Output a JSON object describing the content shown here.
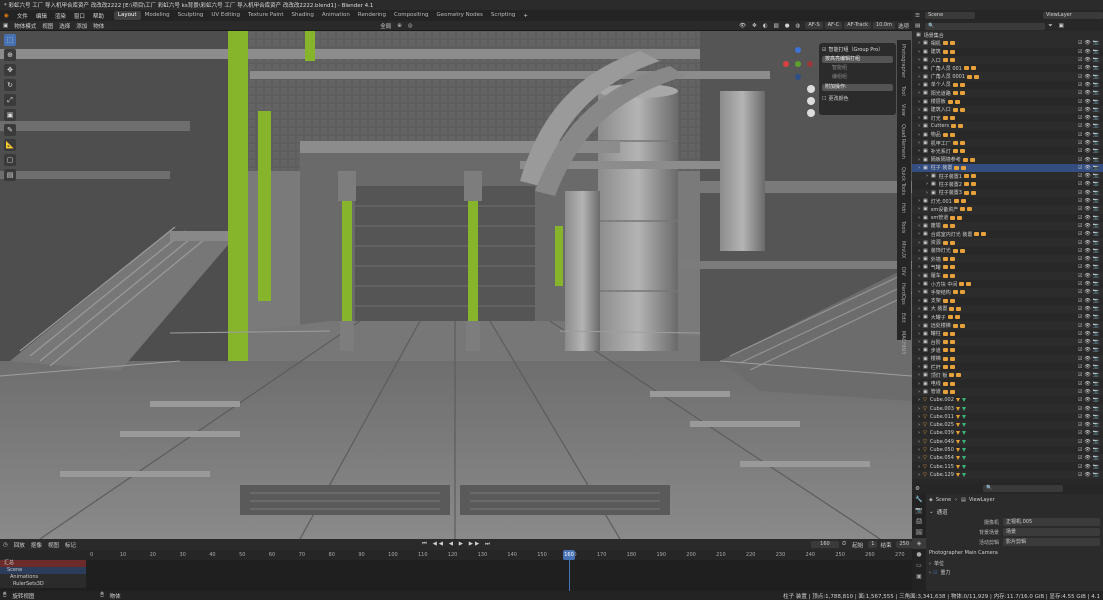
{
  "window": {
    "title": "* 彩虹六号 工厂 导入机甲合库资产 改改改2222 [E:\\项目\\工厂 彩虹六号 ks背景\\彩虹六号 工厂 导入机甲合库资产 改改改2222.blend1] - Blender 4.1"
  },
  "menu": [
    "文件",
    "编辑",
    "渲染",
    "窗口",
    "帮助"
  ],
  "workspaces": [
    "Layout",
    "Modeling",
    "Sculpting",
    "UV Editing",
    "Texture Paint",
    "Shading",
    "Animation",
    "Rendering",
    "Compositing",
    "Geometry Nodes",
    "Scripting"
  ],
  "scene_selector": {
    "scene": "Scene",
    "view_layer": "ViewLayer"
  },
  "viewport_header": {
    "mode": "物体模式",
    "menus": [
      "视图",
      "选择",
      "添加",
      "物体"
    ],
    "transform": "全局",
    "chips": [
      "AF-S",
      "AF-C",
      "AF-Track",
      "10.0m"
    ]
  },
  "addon_panel": {
    "header": "智能打组（Group Pro）",
    "btn_main": "按高亮编辑打组",
    "sub1": "智能组",
    "sub2": "编组组",
    "btn_ops": "附加操作:",
    "check": "更改颜色"
  },
  "n_tabs": [
    "Photographer",
    "Tool",
    "View",
    "Quad Remesh",
    "Quick Tools",
    "Hdri",
    "Tools",
    "MiniUX",
    "DIV",
    "HardOps",
    "Edit",
    "MACHIN3"
  ],
  "timeline": {
    "menus": [
      "回放",
      "抠像",
      "视图",
      "标记"
    ],
    "current_frame": "160",
    "start_label": "起始",
    "start": "1",
    "end_label": "结束",
    "end": "250",
    "ticks": [
      "0",
      "10",
      "20",
      "30",
      "40",
      "50",
      "60",
      "70",
      "80",
      "90",
      "100",
      "110",
      "120",
      "130",
      "140",
      "150",
      "160",
      "170",
      "180",
      "190",
      "200",
      "210",
      "220",
      "230",
      "240",
      "250",
      "260",
      "270"
    ],
    "channels": [
      "汇总",
      "Scene",
      "Animations",
      "RulerSets3D"
    ]
  },
  "outliner": {
    "root": "场景集合",
    "rows": [
      {
        "name": "相机",
        "t": "c"
      },
      {
        "name": "建筑",
        "t": "c"
      },
      {
        "name": "入口",
        "t": "c"
      },
      {
        "name": "广角人员 001",
        "t": "c"
      },
      {
        "name": "广角人员 0001",
        "t": "c"
      },
      {
        "name": "单个人员",
        "t": "c"
      },
      {
        "name": "阳光道路",
        "t": "c"
      },
      {
        "name": "楼层板",
        "t": "c"
      },
      {
        "name": "建筑入口",
        "t": "c"
      },
      {
        "name": "灯光",
        "t": "c"
      },
      {
        "name": "Cutters",
        "t": "c"
      },
      {
        "name": "物品",
        "t": "c"
      },
      {
        "name": "机甲工厂",
        "t": "c"
      },
      {
        "name": "补光系灯",
        "t": "c"
      },
      {
        "name": "隔板隔墙参考",
        "t": "c"
      },
      {
        "name": "柱子 装置",
        "t": "c",
        "sel": true
      },
      {
        "name": "柱子装置1",
        "t": "c",
        "ind": 1
      },
      {
        "name": "柱子装置2",
        "t": "c",
        "ind": 1
      },
      {
        "name": "柱子装置3",
        "t": "c",
        "ind": 1
      },
      {
        "name": "灯光.001",
        "t": "c"
      },
      {
        "name": "sm设备资产",
        "t": "c"
      },
      {
        "name": "sm管道",
        "t": "c"
      },
      {
        "name": "废墟",
        "t": "c"
      },
      {
        "name": "合成室内灯光 装置",
        "t": "c"
      },
      {
        "name": "资源",
        "t": "c"
      },
      {
        "name": "装饰灯光",
        "t": "c"
      },
      {
        "name": "外墙",
        "t": "c"
      },
      {
        "name": "气罐",
        "t": "c"
      },
      {
        "name": "履车",
        "t": "c"
      },
      {
        "name": "小方块 中间",
        "t": "c"
      },
      {
        "name": "手架结构",
        "t": "c"
      },
      {
        "name": "支架",
        "t": "c"
      },
      {
        "name": "大 装置",
        "t": "c"
      },
      {
        "name": "大罐子",
        "t": "c"
      },
      {
        "name": "远处楼梯",
        "t": "c"
      },
      {
        "name": "罐柱",
        "t": "c"
      },
      {
        "name": "台阶",
        "t": "c"
      },
      {
        "name": "步道",
        "t": "c"
      },
      {
        "name": "楼梯",
        "t": "c"
      },
      {
        "name": "栏杆",
        "t": "c"
      },
      {
        "name": "顶灯 板",
        "t": "c"
      },
      {
        "name": "电线",
        "t": "c"
      },
      {
        "name": "管道",
        "t": "c"
      },
      {
        "name": "Cube.002",
        "t": "m"
      },
      {
        "name": "Cube.003",
        "t": "m"
      },
      {
        "name": "Cube.011",
        "t": "m"
      },
      {
        "name": "Cube.025",
        "t": "m"
      },
      {
        "name": "Cube.039",
        "t": "m"
      },
      {
        "name": "Cube.049",
        "t": "m"
      },
      {
        "name": "Cube.050",
        "t": "m"
      },
      {
        "name": "Cube.054",
        "t": "m"
      },
      {
        "name": "Cube.115",
        "t": "m"
      },
      {
        "name": "Cube.129",
        "t": "m"
      }
    ]
  },
  "properties": {
    "breadcrumb_scene": "Scene",
    "breadcrumb_layer": "ViewLayer",
    "section": "通道",
    "fields": [
      {
        "label": "摄像机",
        "value": "正视机.005"
      },
      {
        "label": "背景场景",
        "value": "场景"
      },
      {
        "label": "活动剪辑",
        "value": "影片剪辑"
      }
    ],
    "photographer": "Photographer Main Camera",
    "units": "单位",
    "gravity": "重力"
  },
  "status": {
    "left1": "旋转视图",
    "left2": "物体",
    "right": "柱子 装置 | 顶点:1,788,810 | 面:1,567,555 | 三角面:3,341,638 | 物体:0/11,929 | 内存:11.7/16.0 GiB | 显存:4.55 GiB | 4.1"
  }
}
